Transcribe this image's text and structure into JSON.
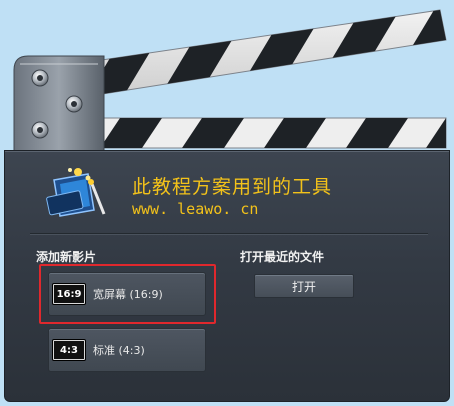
{
  "brand": {
    "headline": "此教程方案用到的工具",
    "url": "www. leawo. cn"
  },
  "left_section": {
    "title": "添加新影片",
    "presets": [
      {
        "badge": "16:9",
        "label": "宽屏幕 (16:9)",
        "highlighted": true
      },
      {
        "badge": "4:3",
        "label": "标准 (4:3)",
        "highlighted": false
      }
    ]
  },
  "right_section": {
    "title": "打开最近的文件",
    "open_button": "打开"
  },
  "colors": {
    "accent_text": "#f3c21a",
    "highlight_border": "#e0282d",
    "slate_body": "#333a44",
    "background": "#bfe0f5"
  },
  "icons": [
    "clapperboard-arm",
    "hinge-bolt-icon",
    "film-logo-icon"
  ]
}
